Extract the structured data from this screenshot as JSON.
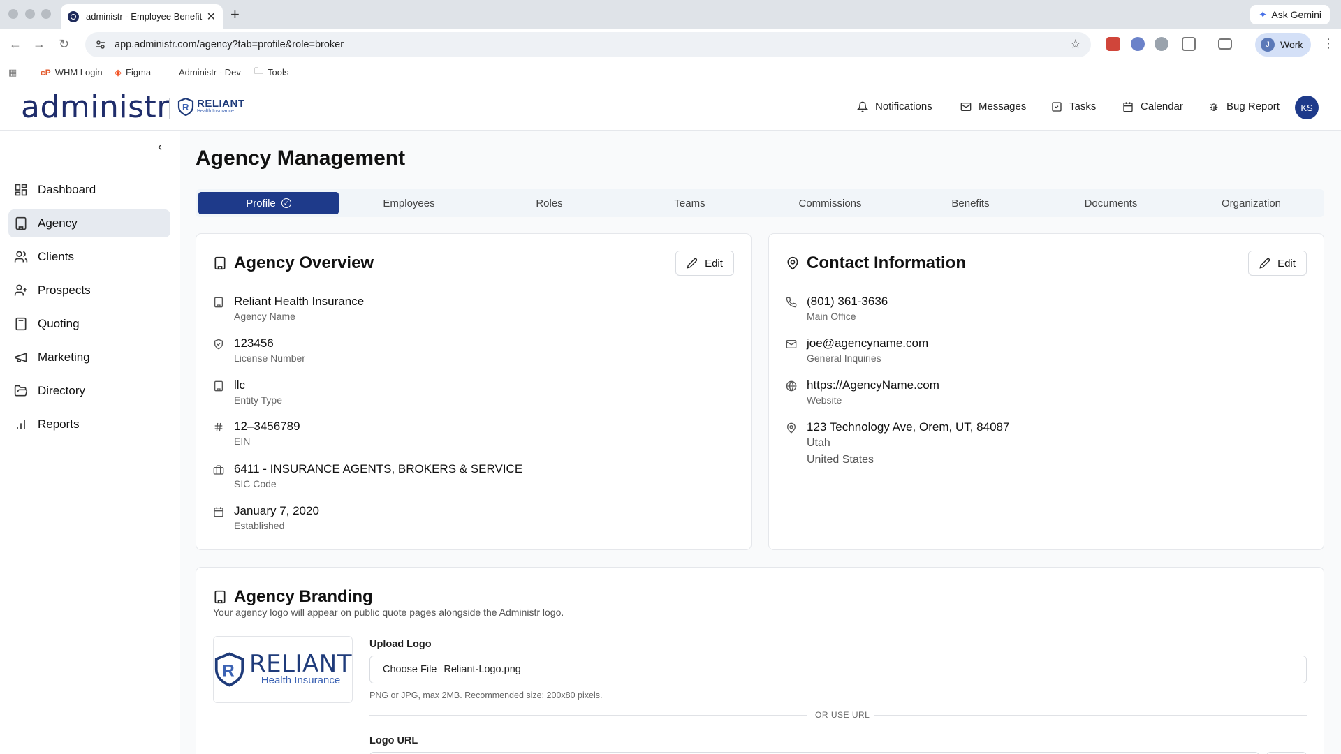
{
  "browser": {
    "tab_title": "administr - Employee Benefit",
    "new_tab": "+",
    "close": "✕",
    "ask_gemini": "Ask Gemini",
    "url": "app.administr.com/agency?tab=profile&role=broker",
    "profile_initial": "J",
    "profile_label": "Work",
    "bookmarks": [
      {
        "label": "WHM Login",
        "icon": "whm-icon"
      },
      {
        "label": "Figma",
        "icon": "figma-icon"
      },
      {
        "label": "Administr - Dev",
        "icon": "none"
      },
      {
        "label": "Tools",
        "icon": "folder-icon"
      }
    ]
  },
  "header": {
    "logo": "administr",
    "partner_logo_name": "RELIANT",
    "partner_logo_sub": "Health Insurance",
    "nav": [
      {
        "label": "Notifications",
        "icon": "bell-icon"
      },
      {
        "label": "Messages",
        "icon": "mail-icon"
      },
      {
        "label": "Tasks",
        "icon": "check-square-icon"
      },
      {
        "label": "Calendar",
        "icon": "calendar-icon"
      },
      {
        "label": "Bug Report",
        "icon": "bug-icon"
      }
    ],
    "user_initials": "KS"
  },
  "sidebar": {
    "items": [
      {
        "label": "Dashboard",
        "icon": "grid-icon",
        "active": false
      },
      {
        "label": "Agency",
        "icon": "building-icon",
        "active": true
      },
      {
        "label": "Clients",
        "icon": "users-icon",
        "active": false
      },
      {
        "label": "Prospects",
        "icon": "user-plus-icon",
        "active": false
      },
      {
        "label": "Quoting",
        "icon": "calculator-icon",
        "active": false
      },
      {
        "label": "Marketing",
        "icon": "megaphone-icon",
        "active": false
      },
      {
        "label": "Directory",
        "icon": "folder-open-icon",
        "active": false
      },
      {
        "label": "Reports",
        "icon": "bar-chart-icon",
        "active": false
      }
    ]
  },
  "main": {
    "title": "Agency Management",
    "tabs": [
      {
        "label": "Profile",
        "active": true
      },
      {
        "label": "Employees"
      },
      {
        "label": "Roles"
      },
      {
        "label": "Teams"
      },
      {
        "label": "Commissions"
      },
      {
        "label": "Benefits"
      },
      {
        "label": "Documents"
      },
      {
        "label": "Organization"
      }
    ],
    "overview": {
      "title": "Agency Overview",
      "edit": "Edit",
      "fields": [
        {
          "value": "Reliant Health Insurance",
          "label": "Agency Name",
          "icon": "building-icon"
        },
        {
          "value": "123456",
          "label": "License Number",
          "icon": "shield-check-icon"
        },
        {
          "value": "llc",
          "label": "Entity Type",
          "icon": "building-icon"
        },
        {
          "value": "12–3456789",
          "label": "EIN",
          "icon": "hash-icon"
        },
        {
          "value": "6411 - INSURANCE AGENTS, BROKERS & SERVICE",
          "label": "SIC Code",
          "icon": "briefcase-icon"
        },
        {
          "value": "January 7, 2020",
          "label": "Established",
          "icon": "calendar-icon"
        }
      ]
    },
    "contact": {
      "title": "Contact Information",
      "edit": "Edit",
      "fields": [
        {
          "value": "(801) 361-3636",
          "label": "Main Office",
          "icon": "phone-icon"
        },
        {
          "value": "joe@agencyname.com",
          "label": "General Inquiries",
          "icon": "mail-icon"
        },
        {
          "value": "https://AgencyName.com",
          "label": "Website",
          "icon": "globe-icon"
        },
        {
          "value": "123 Technology Ave, Orem, UT, 84087",
          "line2": "Utah",
          "line3": "United States",
          "icon": "map-pin-icon"
        }
      ]
    },
    "branding": {
      "title": "Agency Branding",
      "subtitle": "Your agency logo will appear on public quote pages alongside the Administr logo.",
      "logo_name": "RELIANT",
      "logo_sub": "Health Insurance",
      "upload_label": "Upload Logo",
      "choose_file": "Choose File",
      "file_name": "Reliant-Logo.png",
      "hint": "PNG or JPG, max 2MB. Recommended size: 200x80 pixels.",
      "or_use_url": "OR USE URL",
      "url_label": "Logo URL"
    }
  }
}
